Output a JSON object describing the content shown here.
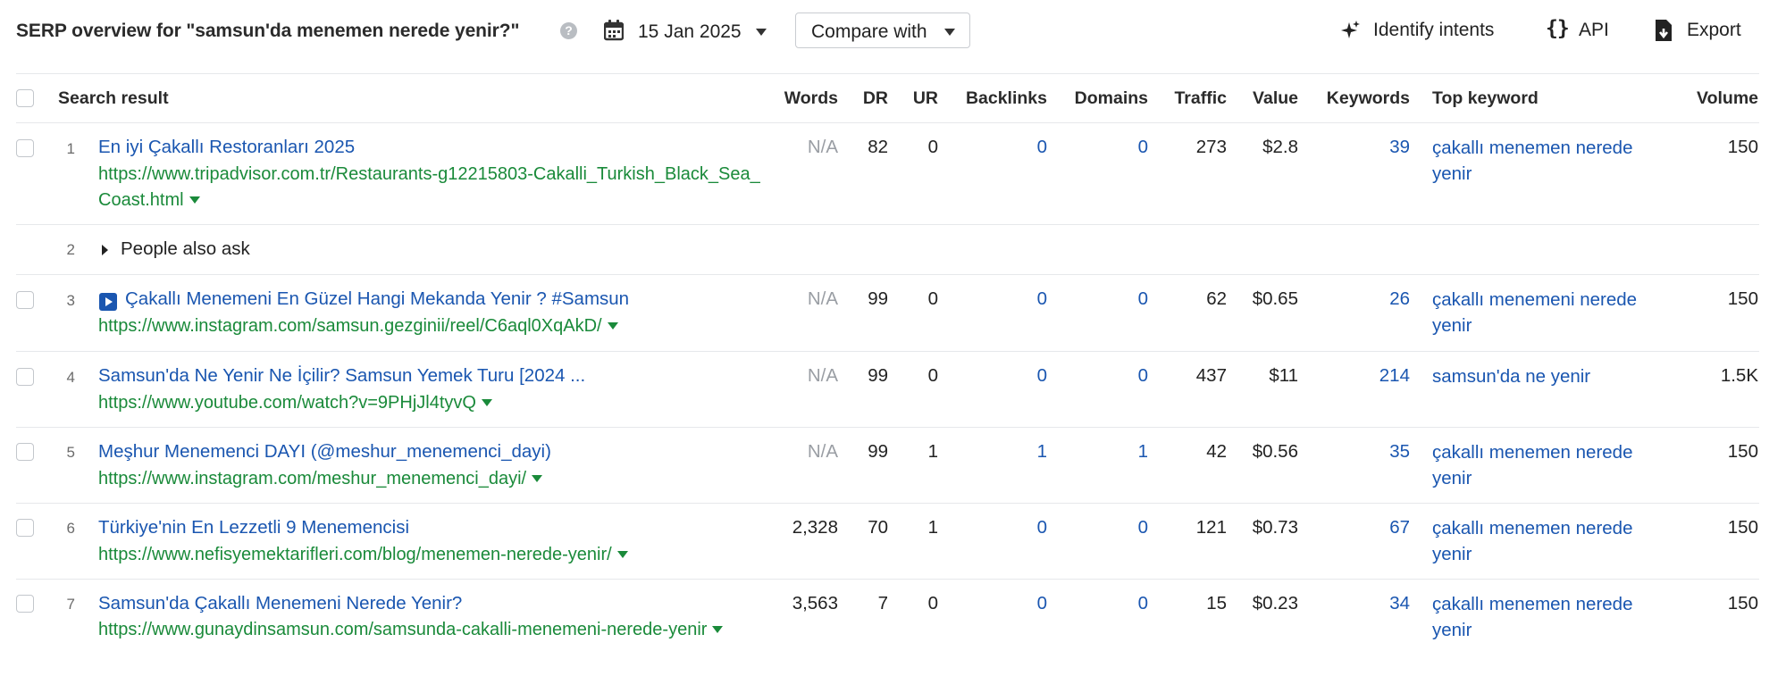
{
  "header": {
    "title": "SERP overview for \"samsun'da menemen nerede yenir?\"",
    "help_glyph": "?",
    "date": "15 Jan 2025",
    "compare_label": "Compare with",
    "identify_label": "Identify intents",
    "api_label": "API",
    "export_label": "Export"
  },
  "columns": {
    "search_result": "Search result",
    "words": "Words",
    "dr": "DR",
    "ur": "UR",
    "backlinks": "Backlinks",
    "domains": "Domains",
    "traffic": "Traffic",
    "value": "Value",
    "keywords": "Keywords",
    "top_keyword": "Top keyword",
    "volume": "Volume"
  },
  "rows": [
    {
      "num": "1",
      "title": "En iyi Çakallı Restoranları 2025",
      "url": "https://www.tripadvisor.com.tr/Restaurants-g12215803-Cakalli_Turkish_Black_Sea_Coast.html",
      "words": "N/A",
      "dr": "82",
      "ur": "0",
      "backlinks": "0",
      "domains": "0",
      "traffic": "273",
      "value": "$2.8",
      "keywords": "39",
      "top_keyword": "çakallı menemen nerede yenir",
      "volume": "150"
    },
    {
      "num": "2",
      "paa": "People also ask"
    },
    {
      "num": "3",
      "title": "Çakallı Menemeni En Güzel Hangi Mekanda Yenir ? #Samsun",
      "url": "https://www.instagram.com/samsun.gezginii/reel/C6aql0XqAkD/",
      "words": "N/A",
      "dr": "99",
      "ur": "0",
      "backlinks": "0",
      "domains": "0",
      "traffic": "62",
      "value": "$0.65",
      "keywords": "26",
      "top_keyword": "çakallı menemeni nerede yenir",
      "volume": "150"
    },
    {
      "num": "4",
      "title": "Samsun'da Ne Yenir Ne İçilir? Samsun Yemek Turu [2024 ...",
      "url": "https://www.youtube.com/watch?v=9PHjJl4tyvQ",
      "words": "N/A",
      "dr": "99",
      "ur": "0",
      "backlinks": "0",
      "domains": "0",
      "traffic": "437",
      "value": "$11",
      "keywords": "214",
      "top_keyword": "samsun'da ne yenir",
      "volume": "1.5K"
    },
    {
      "num": "5",
      "title": "Meşhur Menemenci DAYI (@meshur_menemenci_dayi)",
      "url": "https://www.instagram.com/meshur_menemenci_dayi/",
      "words": "N/A",
      "dr": "99",
      "ur": "1",
      "backlinks": "1",
      "domains": "1",
      "traffic": "42",
      "value": "$0.56",
      "keywords": "35",
      "top_keyword": "çakallı menemen nerede yenir",
      "volume": "150"
    },
    {
      "num": "6",
      "title": "Türkiye'nin En Lezzetli 9 Menemencisi",
      "url": "https://www.nefisyemektarifleri.com/blog/menemen-nerede-yenir/",
      "words": "2,328",
      "dr": "70",
      "ur": "1",
      "backlinks": "0",
      "domains": "0",
      "traffic": "121",
      "value": "$0.73",
      "keywords": "67",
      "top_keyword": "çakallı menemen nerede yenir",
      "volume": "150"
    },
    {
      "num": "7",
      "title": "Samsun'da Çakallı Menemeni Nerede Yenir?",
      "url": "https://www.gunaydinsamsun.com/samsunda-cakalli-menemeni-nerede-yenir",
      "words": "3,563",
      "dr": "7",
      "ur": "0",
      "backlinks": "0",
      "domains": "0",
      "traffic": "15",
      "value": "$0.23",
      "keywords": "34",
      "top_keyword": "çakallı menemen nerede yenir",
      "volume": "150"
    }
  ]
}
